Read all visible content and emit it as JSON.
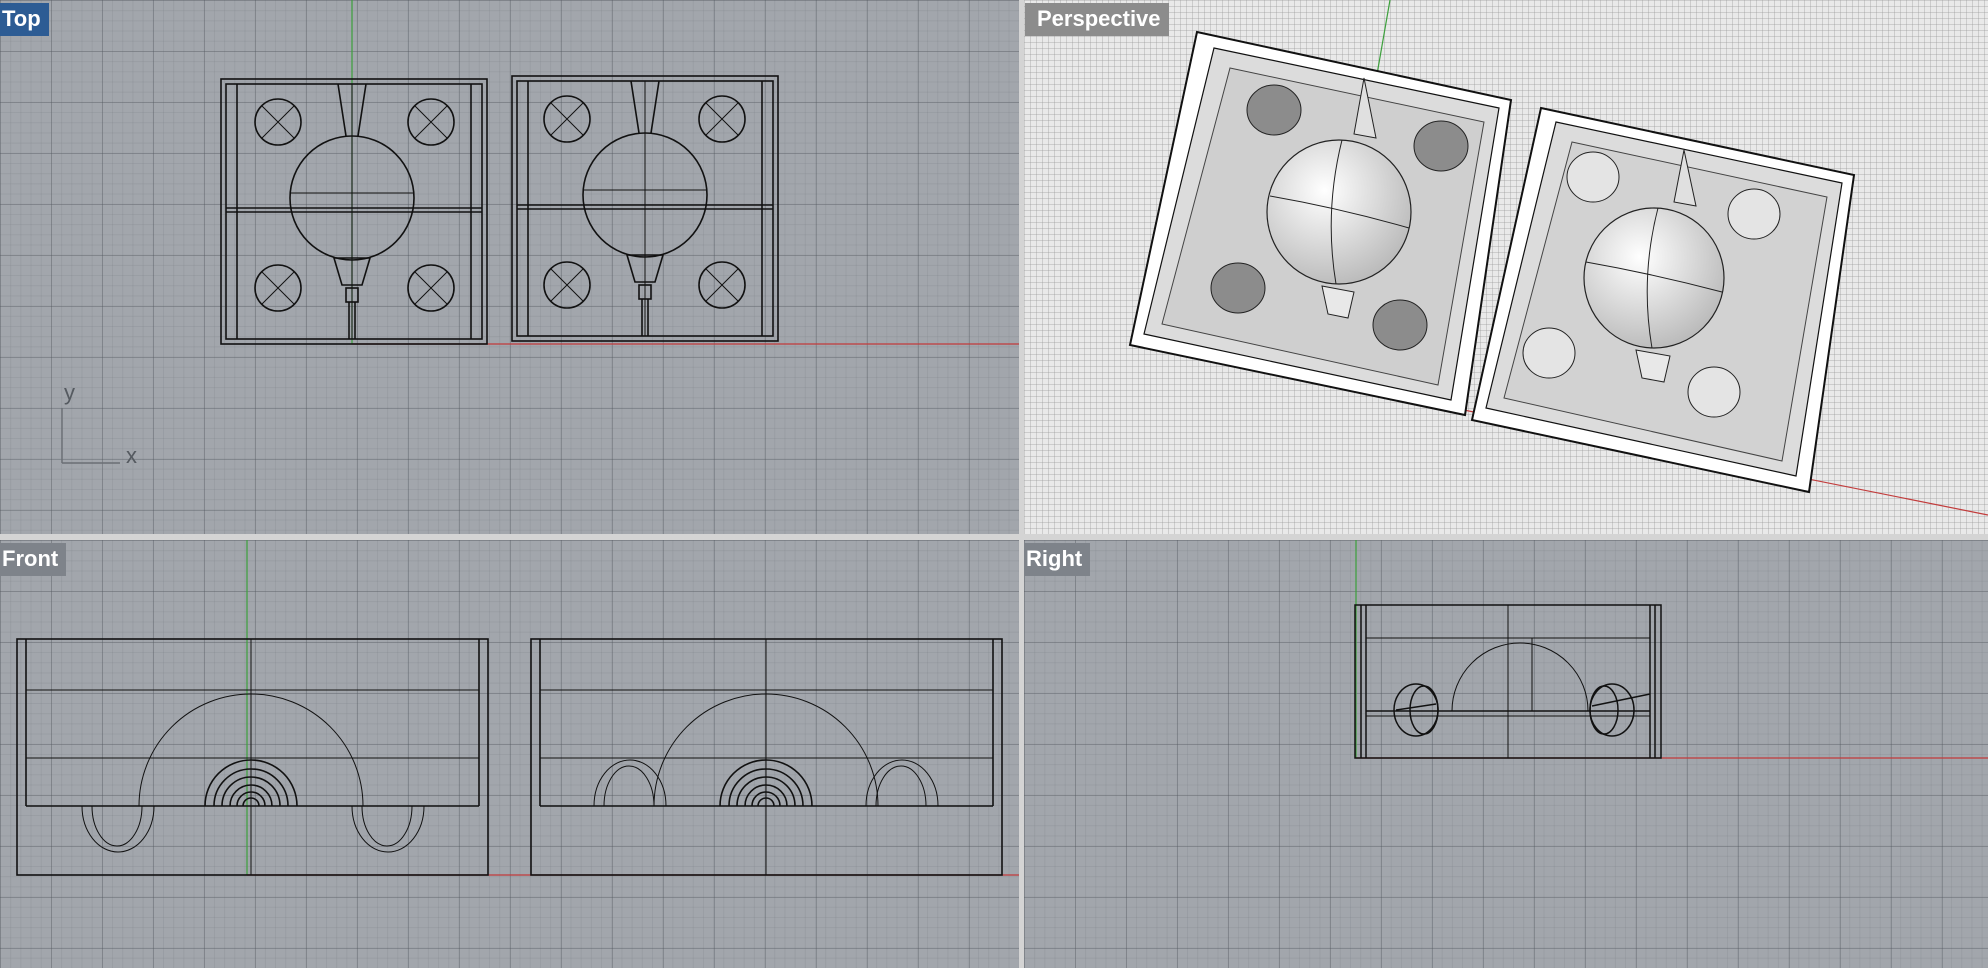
{
  "viewports": {
    "top": {
      "title": "Top",
      "active": true,
      "axis_x": "x",
      "axis_y": "y"
    },
    "perspective": {
      "title": "Perspective"
    },
    "front": {
      "title": "Front"
    },
    "right": {
      "title": "Right"
    }
  },
  "colors": {
    "active_title_bg": "#2d5c94",
    "title_bg": "#7e838a",
    "grid_bg": "#a2a6ac",
    "x_axis": "#c23b3b",
    "y_axis": "#3ca03c",
    "wire": "#111111"
  }
}
